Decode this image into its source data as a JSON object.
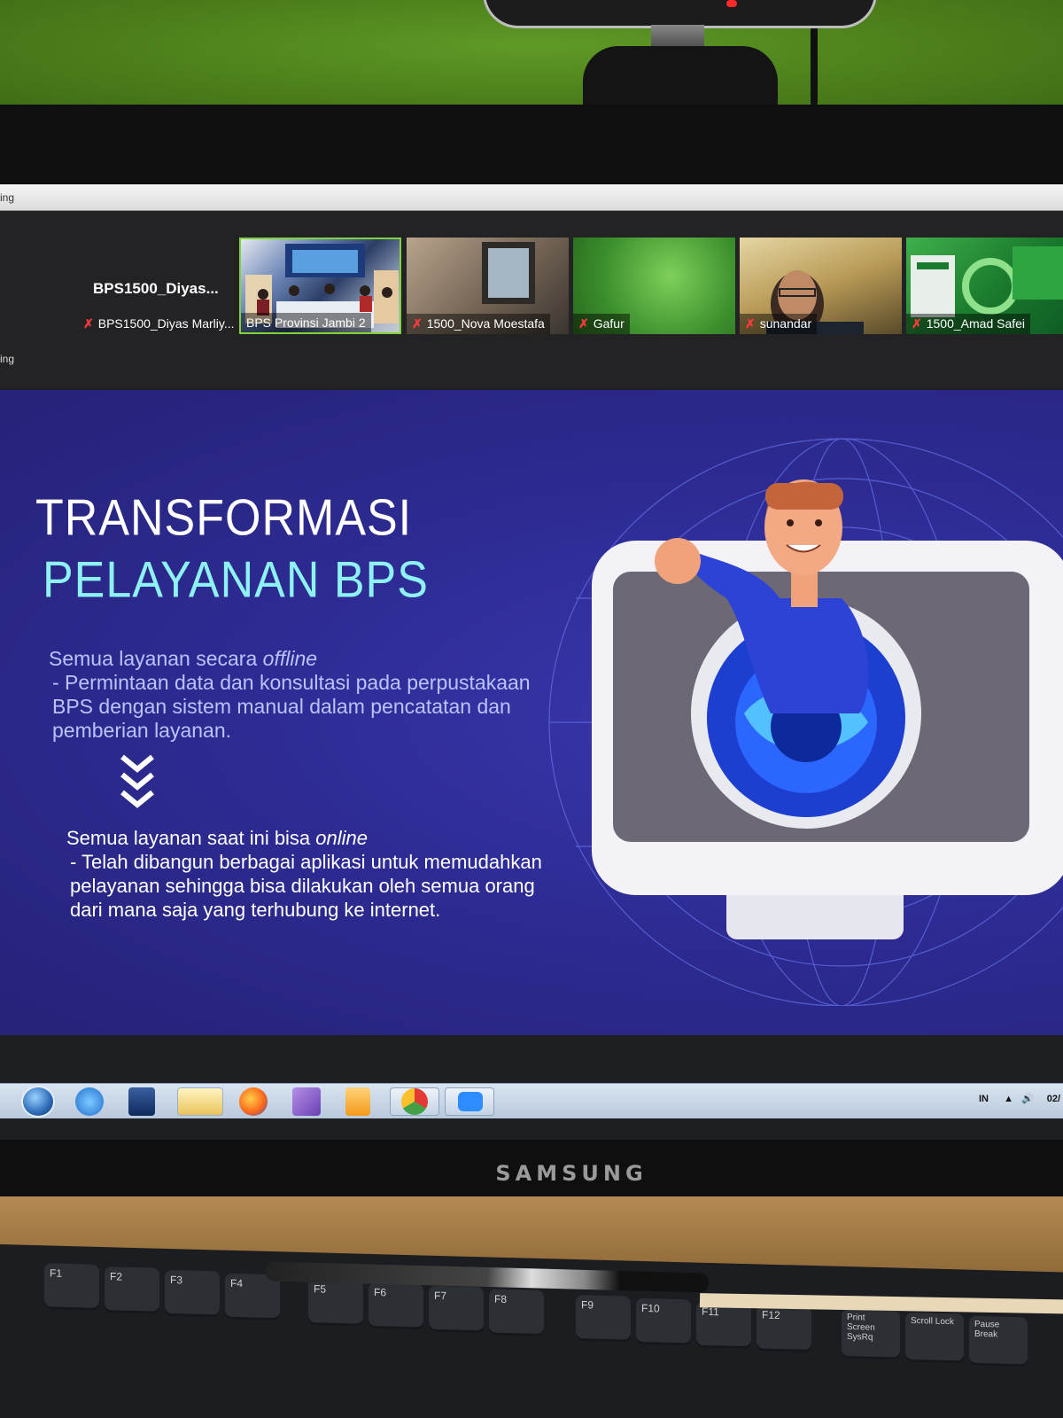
{
  "browser": {
    "partial_title": "ing"
  },
  "zoom": {
    "side_label": "ing",
    "active_speaker": "BPS1500_Diyas...",
    "participants": [
      {
        "name": "BPS1500_Diyas Marliy...",
        "muted": true
      },
      {
        "name": "BPS Provinsi Jambi 2",
        "muted": false
      },
      {
        "name": "1500_Nova Moestafa",
        "muted": true
      },
      {
        "name": "Gafur",
        "muted": true
      },
      {
        "name": "sunandar",
        "muted": true
      },
      {
        "name": "1500_Amad Safei",
        "muted": true
      }
    ]
  },
  "slide": {
    "title_line1": "TRANSFORMASI",
    "title_line2": "PELAYANAN BPS",
    "offline_heading_prefix": "Semua layanan secara ",
    "offline_heading_em": "offline",
    "offline_body": "- Permintaan data dan konsultasi pada perpustakaan BPS dengan sistem manual dalam pencatatan dan pemberian layanan.",
    "online_heading_prefix": "Semua layanan saat ini bisa ",
    "online_heading_em": "online",
    "online_body": "- Telah dibangun berbagai aplikasi untuk memudahkan pelayanan sehingga bisa dilakukan oleh semua orang dari mana saja yang terhubung ke internet.",
    "colors": {
      "background": "#2e2c95",
      "title_accent": "#8ef2f5",
      "offline_text": "#b9c3ff"
    }
  },
  "taskbar": {
    "apps": [
      "windows-start-icon",
      "internet-explorer-icon",
      "app-icon",
      "file-explorer-icon",
      "firefox-icon",
      "vs-icon",
      "media-player-icon",
      "chrome-icon",
      "zoom-icon"
    ],
    "language": "IN",
    "clock_partial": "02/"
  },
  "hardware": {
    "monitor_brand": "SAMSUNG",
    "keys": [
      "F1",
      "F2",
      "F3",
      "F4",
      "F5",
      "F6",
      "F7",
      "F8",
      "F9",
      "F10",
      "F11",
      "F12",
      "Print Screen SysRq",
      "Scroll Lock",
      "Pause Break"
    ]
  }
}
